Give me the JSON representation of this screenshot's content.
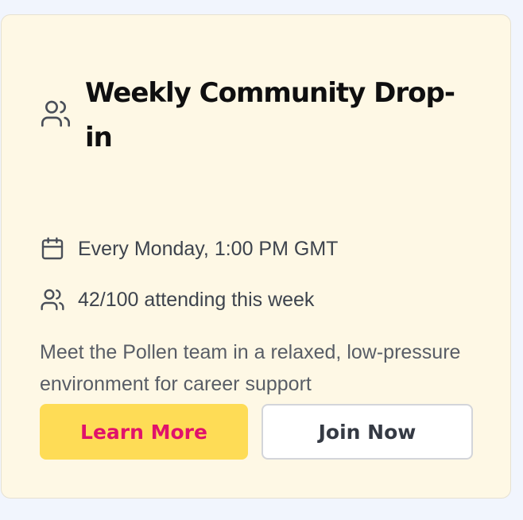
{
  "event": {
    "title": "Weekly Community Drop-in",
    "title_icon": "users-icon",
    "schedule": {
      "icon": "calendar-icon",
      "text": "Every Monday, 1:00 PM GMT"
    },
    "attendance": {
      "icon": "users-icon",
      "text": "42/100 attending this week",
      "attending": 42,
      "capacity": 100
    },
    "description": "Meet the Pollen team in a relaxed, low-pressure environment for career support"
  },
  "actions": {
    "learn_more_label": "Learn More",
    "join_now_label": "Join Now"
  },
  "colors": {
    "card_background": "#fef8e5",
    "page_background": "#f1f5fd",
    "primary_button_background": "#fedc56",
    "primary_button_text": "#e0126b",
    "secondary_button_text": "#353a44"
  }
}
